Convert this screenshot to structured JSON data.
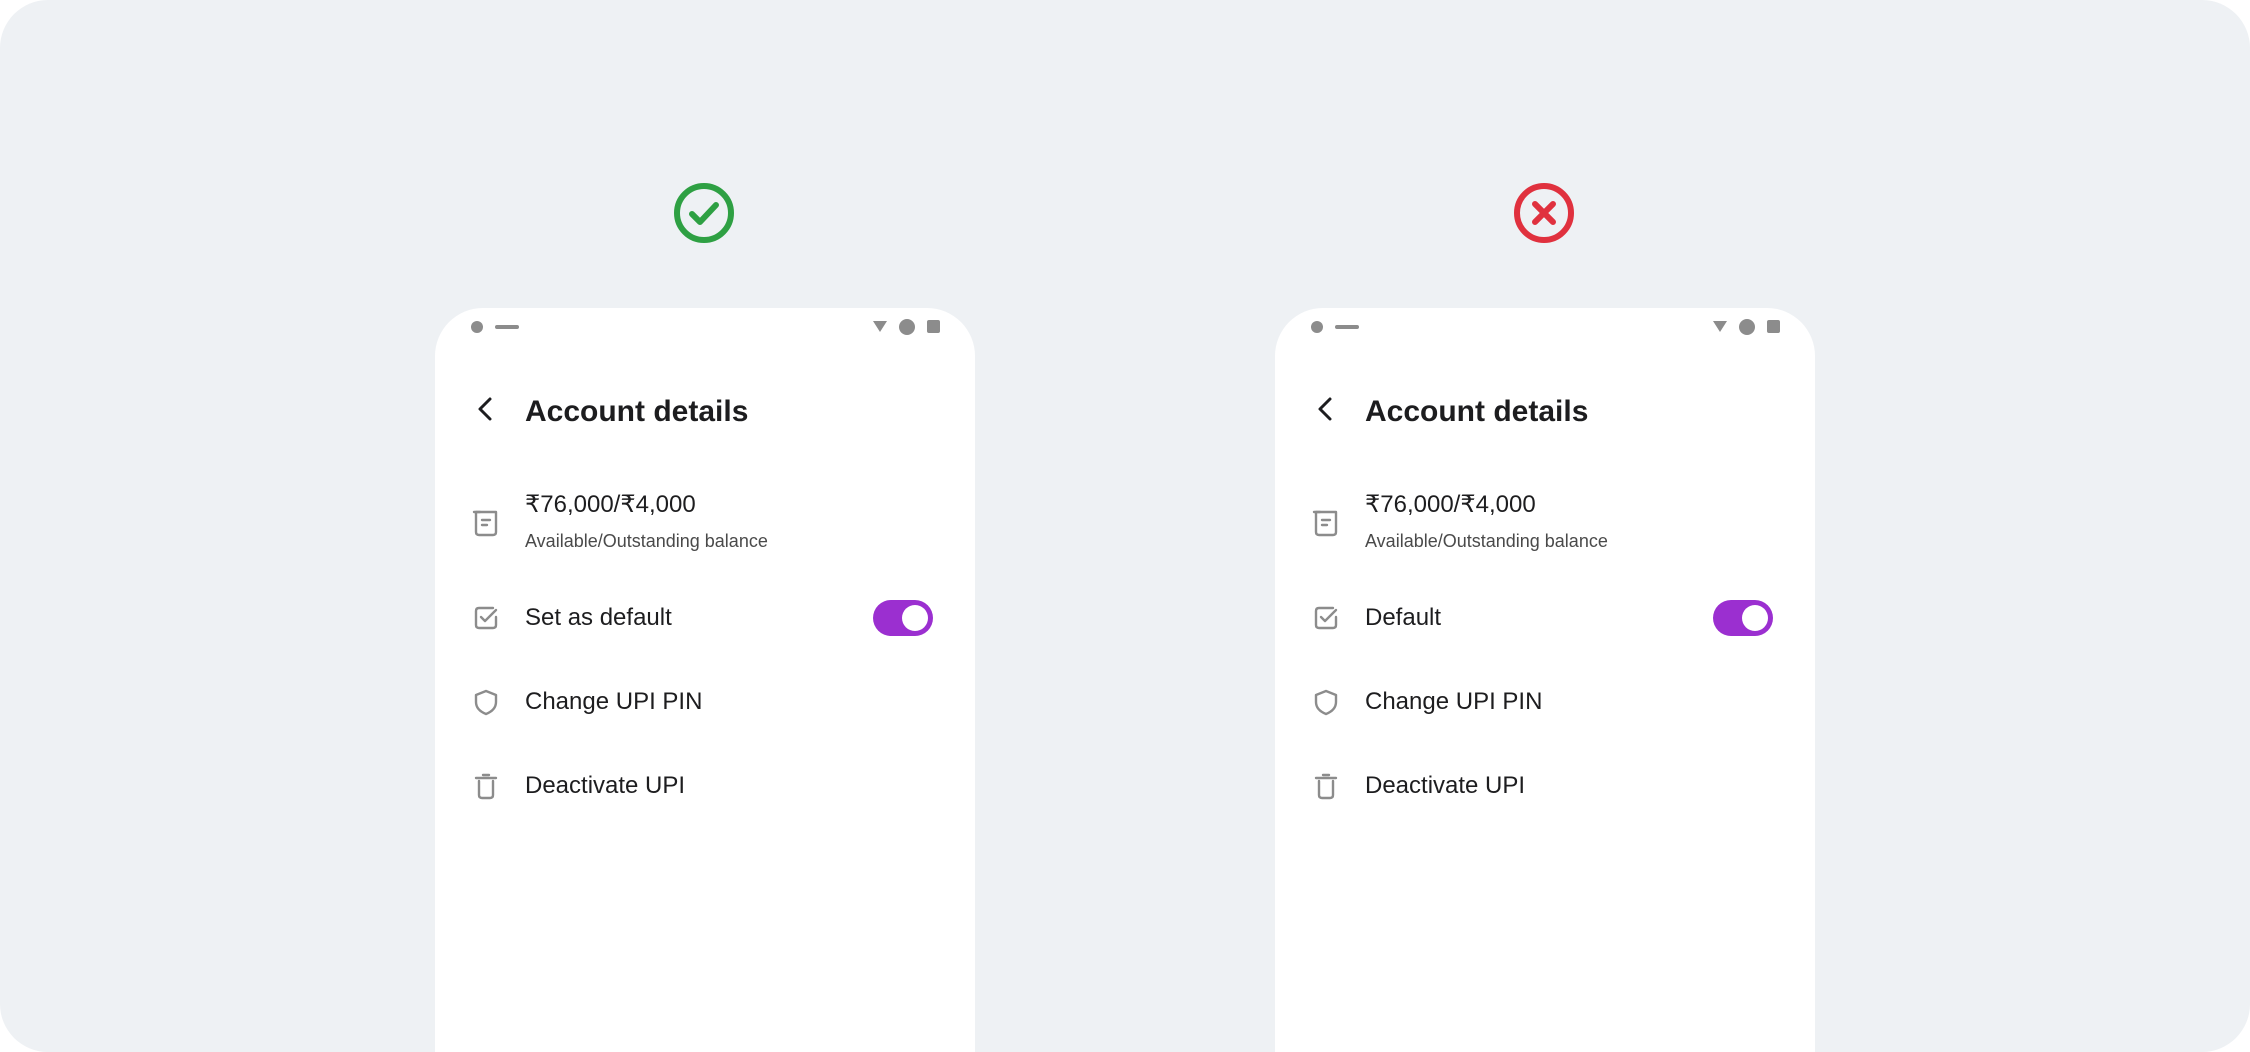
{
  "panels": [
    {
      "verdict": "correct",
      "verdict_icon": "check-circle-icon",
      "verdict_color": "#2ea043",
      "screen": {
        "title": "Account details",
        "balance": {
          "amount": "₹76,000/₹4,000",
          "caption": "Available/Outstanding balance",
          "icon": "receipt-icon"
        },
        "default_row": {
          "label": "Set as default",
          "icon": "checkbox-icon",
          "toggle_on": true
        },
        "pin_row": {
          "label": "Change UPI PIN",
          "icon": "shield-icon"
        },
        "deactivate_row": {
          "label": "Deactivate UPI",
          "icon": "trash-icon"
        }
      }
    },
    {
      "verdict": "incorrect",
      "verdict_icon": "x-circle-icon",
      "verdict_color": "#e0313e",
      "screen": {
        "title": "Account details",
        "balance": {
          "amount": "₹76,000/₹4,000",
          "caption": "Available/Outstanding balance",
          "icon": "receipt-icon"
        },
        "default_row": {
          "label": "Default",
          "icon": "checkbox-icon",
          "toggle_on": true
        },
        "pin_row": {
          "label": "Change UPI PIN",
          "icon": "shield-icon"
        },
        "deactivate_row": {
          "label": "Deactivate UPI",
          "icon": "trash-icon"
        }
      }
    }
  ],
  "colors": {
    "background": "#eef1f4",
    "toggle_accent": "#9b2fd0",
    "icon_gray": "#8c8c8c",
    "text_primary": "#1d1d1f",
    "text_secondary": "#4a4a4a"
  }
}
